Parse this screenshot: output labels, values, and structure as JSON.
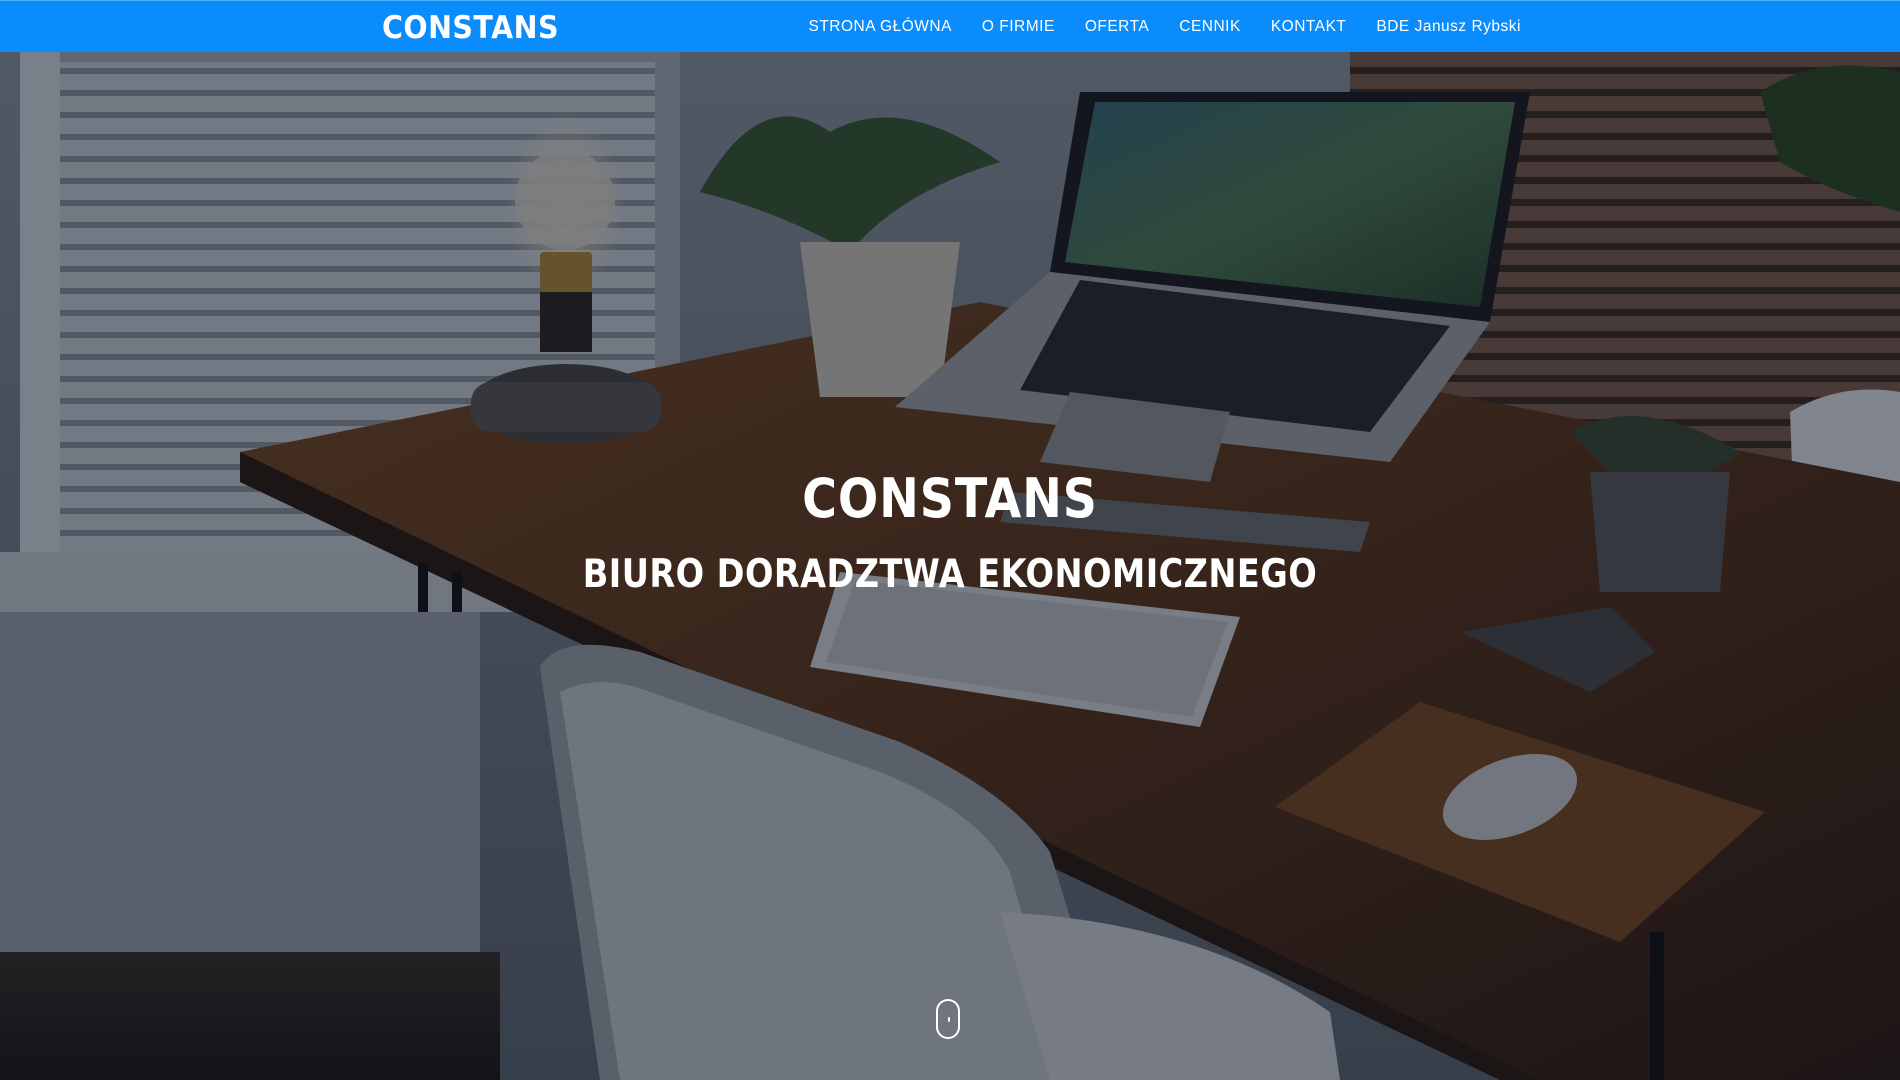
{
  "navbar": {
    "brand": "CONSTANS",
    "background": "#0a8cfd",
    "links": [
      {
        "label": "STRONA GŁÓWNA"
      },
      {
        "label": "O FIRMIE"
      },
      {
        "label": "OFERTA"
      },
      {
        "label": "CENNIK"
      },
      {
        "label": "KONTAKT"
      },
      {
        "label": "BDE Janusz Rybski"
      }
    ]
  },
  "hero": {
    "title": "CONSTANS",
    "subtitle": "BIURO DORADZTWA EKONOMICZNEGO",
    "scroll_icon": "mouse-scroll-icon"
  }
}
